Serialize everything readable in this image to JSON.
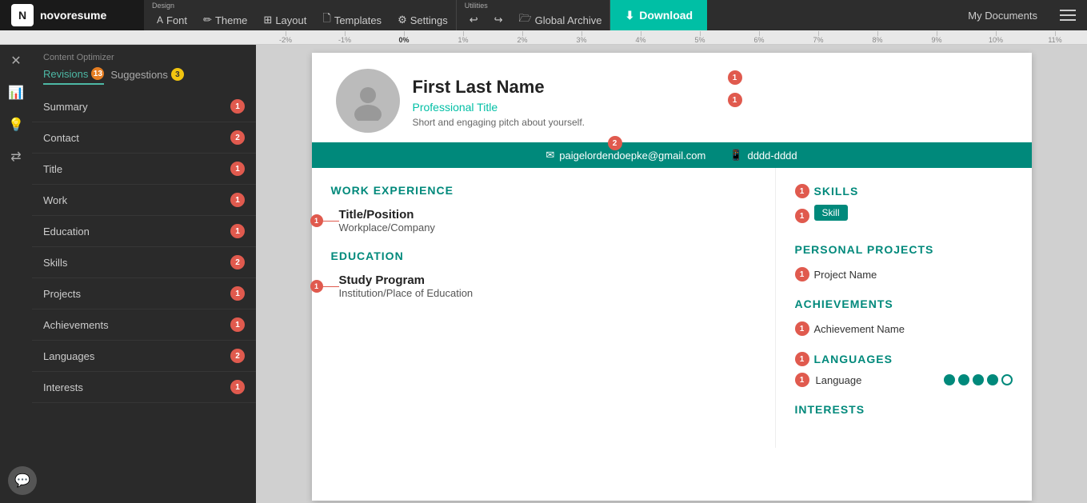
{
  "logo": {
    "icon": "N",
    "text": "novoresume"
  },
  "nav": {
    "design_label": "Design",
    "utilities_label": "Utilities",
    "font_label": "Font",
    "theme_label": "Theme",
    "layout_label": "Layout",
    "templates_label": "Templates",
    "settings_label": "Settings",
    "undo_icon": "↩",
    "redo_icon": "↪",
    "global_archive_label": "Global Archive",
    "download_label": "Download",
    "my_docs_label": "My Documents"
  },
  "ruler": {
    "marks": [
      "-2%",
      "-1%",
      "0%",
      "1%",
      "2%",
      "3%",
      "4%",
      "5%",
      "6%",
      "7%",
      "8%",
      "9%",
      "10%",
      "11%"
    ]
  },
  "sidebar": {
    "title": "Content Optimizer",
    "tabs": [
      {
        "label": "Revisions",
        "badge": "13",
        "badge_type": "orange",
        "active": true
      },
      {
        "label": "Suggestions",
        "badge": "3",
        "badge_type": "yellow",
        "active": false
      }
    ],
    "sections": [
      {
        "label": "Summary",
        "count": "1"
      },
      {
        "label": "Contact",
        "count": "2"
      },
      {
        "label": "Title",
        "count": "1"
      },
      {
        "label": "Work",
        "count": "1"
      },
      {
        "label": "Education",
        "count": "1"
      },
      {
        "label": "Skills",
        "count": "2"
      },
      {
        "label": "Projects",
        "count": "1"
      },
      {
        "label": "Achievements",
        "count": "1"
      },
      {
        "label": "Languages",
        "count": "2"
      },
      {
        "label": "Interests",
        "count": "1"
      }
    ],
    "icons": [
      "✕",
      "📊",
      "💡",
      "⇄"
    ]
  },
  "resume": {
    "avatar_alt": "avatar",
    "name": "First Last Name",
    "professional_title": "Professional Title",
    "pitch": "Short and engaging pitch about yourself.",
    "email": "paigelordendoepke@gmail.com",
    "phone": "dddd-dddd",
    "sections": {
      "work_experience": {
        "heading": "WORK EXPERIENCE",
        "items": [
          {
            "title": "Title/Position",
            "company": "Workplace/Company"
          }
        ]
      },
      "education": {
        "heading": "EDUCATION",
        "items": [
          {
            "program": "Study Program",
            "institution": "Institution/Place of Education"
          }
        ]
      },
      "skills": {
        "heading": "SKILLS",
        "items": [
          "Skill"
        ]
      },
      "personal_projects": {
        "heading": "PERSONAL PROJECTS",
        "items": [
          "Project Name"
        ]
      },
      "achievements": {
        "heading": "ACHIEVEMENTS",
        "items": [
          "Achievement Name"
        ]
      },
      "languages": {
        "heading": "LANGUAGES",
        "items": [
          {
            "label": "Language",
            "filled": 4,
            "total": 5
          }
        ]
      },
      "interests": {
        "heading": "INTERESTS"
      }
    }
  },
  "colors": {
    "teal": "#00897b",
    "teal_light": "#00bfa5",
    "red_badge": "#e05a4e",
    "nav_bg": "#2d2d2d",
    "sidebar_bg": "#2a2a2a"
  }
}
